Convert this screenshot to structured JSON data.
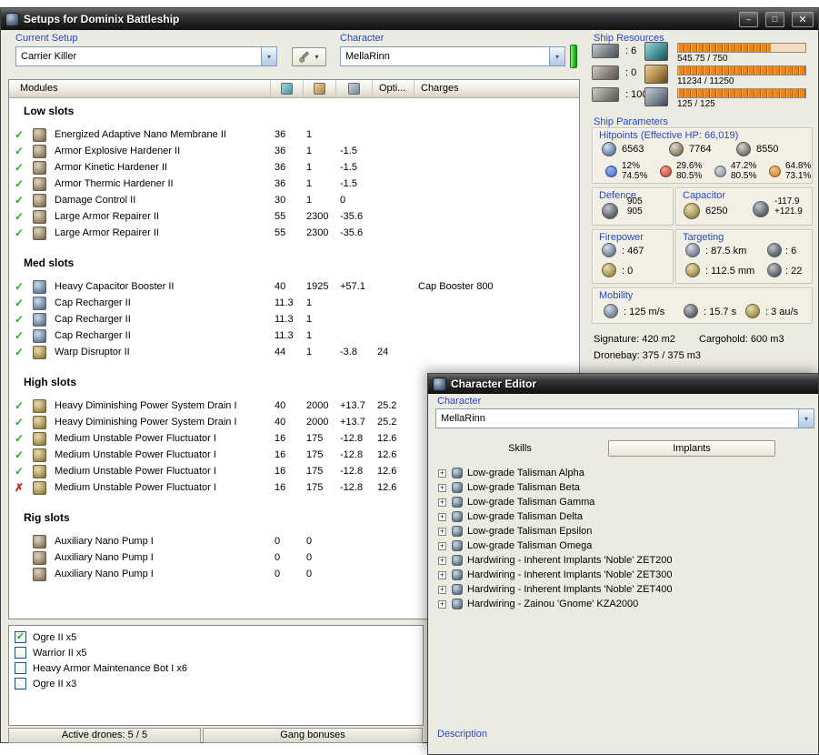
{
  "colors": {
    "accent_blue": "#2946c6",
    "bar_orange": "#ef8414",
    "ok_green": "#2ba52b",
    "error_red": "#cc2020",
    "character_status_green": "#27c627"
  },
  "main_window": {
    "title": "Setups for Dominix Battleship",
    "current_setup_label": "Current Setup",
    "current_setup_value": "Carrier Killer",
    "character_label": "Character",
    "character_value": "MellaRinn",
    "ship_resources": {
      "label": "Ship Resources",
      "slots": [
        {
          "name": "turret_hardpoints",
          "value": ": 6"
        },
        {
          "name": "launcher_hardpoints",
          "value": ": 0"
        },
        {
          "name": "calibration",
          "value": ": 100"
        }
      ],
      "bars": [
        {
          "name": "cpu",
          "icon": "cpu-icon",
          "text": "545.75 / 750",
          "fill": 0.73
        },
        {
          "name": "powergrid",
          "icon": "powergrid-icon",
          "text": "11234 / 11250",
          "fill": 0.998
        },
        {
          "name": "bandwidth",
          "icon": "bandwidth-icon",
          "text": "125 / 125",
          "fill": 1
        }
      ]
    },
    "modules_table": {
      "header": "Modules",
      "opti_header": "Opti...",
      "charges_header": "Charges"
    },
    "sections": [
      {
        "name": "Low slots",
        "rows": [
          {
            "status": "ok",
            "name": "Energized Adaptive Nano Membrane II",
            "v1": "36",
            "v2": "1",
            "v3": "",
            "v4": "",
            "charge": ""
          },
          {
            "status": "ok",
            "name": "Armor Explosive Hardener II",
            "v1": "36",
            "v2": "1",
            "v3": "-1.5",
            "v4": "",
            "charge": ""
          },
          {
            "status": "ok",
            "name": "Armor Kinetic Hardener II",
            "v1": "36",
            "v2": "1",
            "v3": "-1.5",
            "v4": "",
            "charge": ""
          },
          {
            "status": "ok",
            "name": "Armor Thermic Hardener II",
            "v1": "36",
            "v2": "1",
            "v3": "-1.5",
            "v4": "",
            "charge": ""
          },
          {
            "status": "ok",
            "name": "Damage Control II",
            "v1": "30",
            "v2": "1",
            "v3": "0",
            "v4": "",
            "charge": ""
          },
          {
            "status": "ok",
            "name": "Large Armor Repairer II",
            "v1": "55",
            "v2": "2300",
            "v3": "-35.6",
            "v4": "",
            "charge": ""
          },
          {
            "status": "ok",
            "name": "Large Armor Repairer II",
            "v1": "55",
            "v2": "2300",
            "v3": "-35.6",
            "v4": "",
            "charge": ""
          }
        ]
      },
      {
        "name": "Med slots",
        "rows": [
          {
            "status": "ok",
            "name": "Heavy Capacitor Booster II",
            "v1": "40",
            "v2": "1925",
            "v3": "+57.1",
            "v4": "",
            "charge": "Cap Booster 800"
          },
          {
            "status": "ok",
            "name": "Cap Recharger II",
            "v1": "11.3",
            "v2": "1",
            "v3": "",
            "v4": "",
            "charge": ""
          },
          {
            "status": "ok",
            "name": "Cap Recharger II",
            "v1": "11.3",
            "v2": "1",
            "v3": "",
            "v4": "",
            "charge": ""
          },
          {
            "status": "ok",
            "name": "Cap Recharger II",
            "v1": "11.3",
            "v2": "1",
            "v3": "",
            "v4": "",
            "charge": ""
          },
          {
            "status": "ok",
            "name": "Warp Disruptor II",
            "v1": "44",
            "v2": "1",
            "v3": "-3.8",
            "v4": "24",
            "charge": ""
          }
        ]
      },
      {
        "name": "High slots",
        "rows": [
          {
            "status": "ok",
            "name": "Heavy Diminishing Power System Drain I",
            "v1": "40",
            "v2": "2000",
            "v3": "+13.7",
            "v4": "25.2",
            "charge": ""
          },
          {
            "status": "ok",
            "name": "Heavy Diminishing Power System Drain I",
            "v1": "40",
            "v2": "2000",
            "v3": "+13.7",
            "v4": "25.2",
            "charge": ""
          },
          {
            "status": "ok",
            "name": "Medium Unstable Power Fluctuator I",
            "v1": "16",
            "v2": "175",
            "v3": "-12.8",
            "v4": "12.6",
            "charge": ""
          },
          {
            "status": "ok",
            "name": "Medium Unstable Power Fluctuator I",
            "v1": "16",
            "v2": "175",
            "v3": "-12.8",
            "v4": "12.6",
            "charge": ""
          },
          {
            "status": "ok",
            "name": "Medium Unstable Power Fluctuator I",
            "v1": "16",
            "v2": "175",
            "v3": "-12.8",
            "v4": "12.6",
            "charge": ""
          },
          {
            "status": "error",
            "name": "Medium Unstable Power Fluctuator I",
            "v1": "16",
            "v2": "175",
            "v3": "-12.8",
            "v4": "12.6",
            "charge": ""
          }
        ]
      },
      {
        "name": "Rig slots",
        "rows": [
          {
            "status": "none",
            "name": "Auxiliary Nano Pump I",
            "v1": "0",
            "v2": "0",
            "v3": "",
            "v4": "",
            "charge": ""
          },
          {
            "status": "none",
            "name": "Auxiliary Nano Pump I",
            "v1": "0",
            "v2": "0",
            "v3": "",
            "v4": "",
            "charge": ""
          },
          {
            "status": "none",
            "name": "Auxiliary Nano Pump I",
            "v1": "0",
            "v2": "0",
            "v3": "",
            "v4": "",
            "charge": ""
          }
        ]
      }
    ],
    "drones": [
      {
        "label": "Ogre II x5",
        "checked": true
      },
      {
        "label": "Warrior II x5",
        "checked": false
      },
      {
        "label": "Heavy Armor Maintenance Bot I x6",
        "checked": false
      },
      {
        "label": "Ogre II x3",
        "checked": false
      }
    ],
    "status_bar": {
      "active_drones": "Active drones: 5 / 5",
      "gang_bonuses": "Gang bonuses"
    },
    "ship_parameters": {
      "label": "Ship Parameters",
      "hitpoints": {
        "title": "Hitpoints (Effective HP: 66,019)",
        "shield_hp": "6563",
        "armor_hp": "7764",
        "structure_hp": "8550",
        "resists": [
          {
            "type": "em",
            "shield": "12%",
            "armor": "74.5%"
          },
          {
            "type": "thermal",
            "shield": "29.6%",
            "armor": "80.5%"
          },
          {
            "type": "kinetic",
            "shield": "47.2%",
            "armor": "80.5%"
          },
          {
            "type": "explosive",
            "shield": "64.8%",
            "armor": "73.1%"
          }
        ]
      },
      "defence": {
        "label": "Defence",
        "value_top": "905",
        "value_bottom": "905"
      },
      "capacitor": {
        "label": "Capacitor",
        "capacity": "6250",
        "drain": "-117.9",
        "recharge": "+121.9"
      },
      "firepower": {
        "label": "Firepower",
        "turret_dps": ": 467",
        "launcher_dps": ": 0"
      },
      "targeting": {
        "label": "Targeting",
        "range": ": 87.5 km",
        "max_targets": ": 6",
        "scan_resolution": ": 112.5 mm",
        "sensor_strength": ": 22"
      },
      "mobility": {
        "label": "Mobility",
        "max_velocity": ": 125 m/s",
        "align_time": ": 15.7 s",
        "warp_speed": ": 3 au/s"
      },
      "signature": "Signature: 420 m2",
      "cargohold": "Cargohold: 600 m3",
      "dronebay": "Dronebay: 375 / 375 m3"
    }
  },
  "character_editor": {
    "title": "Character Editor",
    "character_label": "Character",
    "character_value": "MellaRinn",
    "tabs": [
      {
        "label": "Skills",
        "selected": false
      },
      {
        "label": "Implants",
        "selected": true
      }
    ],
    "implants": [
      "Low-grade Talisman Alpha",
      "Low-grade Talisman Beta",
      "Low-grade Talisman Gamma",
      "Low-grade Talisman Delta",
      "Low-grade Talisman Epsilon",
      "Low-grade Talisman Omega",
      "Hardwiring - Inherent Implants 'Noble' ZET200",
      "Hardwiring - Inherent Implants 'Noble' ZET300",
      "Hardwiring - Inherent Implants 'Noble' ZET400",
      "Hardwiring - Zainou 'Gnome' KZA2000"
    ],
    "description_label": "Description"
  }
}
